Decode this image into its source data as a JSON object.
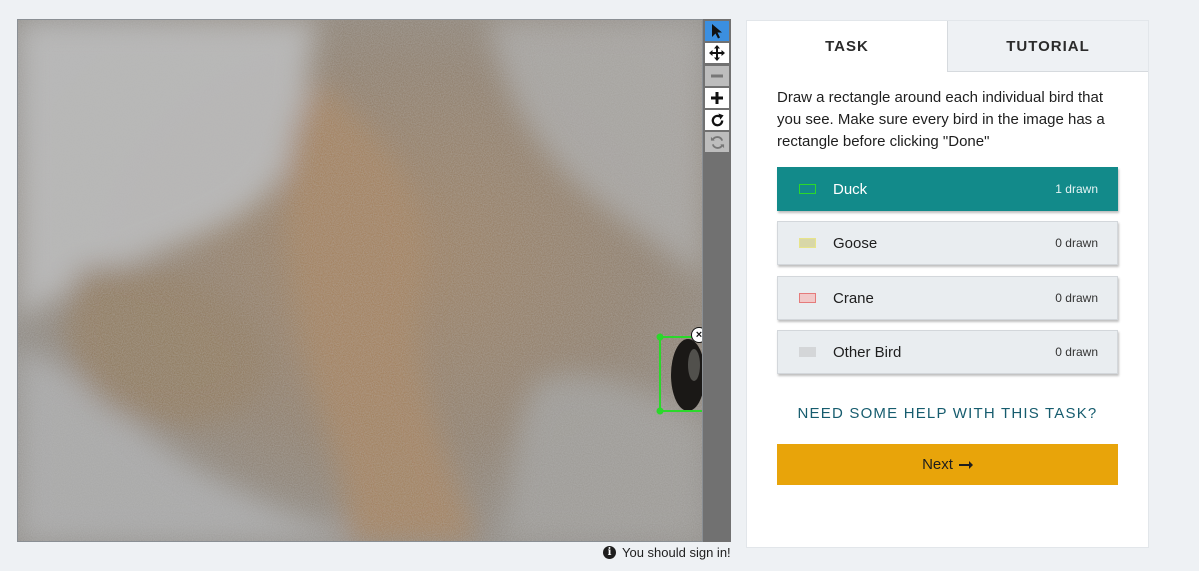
{
  "viewer": {
    "tools": [
      {
        "name": "pointer-icon",
        "state": "active"
      },
      {
        "name": "move-icon",
        "state": "normal"
      },
      {
        "name": "zoom-out-icon",
        "state": "disabled"
      },
      {
        "name": "zoom-in-icon",
        "state": "normal"
      },
      {
        "name": "rotate-icon",
        "state": "normal"
      },
      {
        "name": "reset-icon",
        "state": "disabled"
      }
    ],
    "annotation_color": "#2bd82b"
  },
  "signin_notice": "You should sign in!",
  "task_panel": {
    "tabs": {
      "task": "TASK",
      "tutorial": "TUTORIAL"
    },
    "instructions": "Draw a rectangle around each individual bird that you see. Make sure every bird in the image has a rectangle before clicking \"Done\"",
    "choices": [
      {
        "label": "Duck",
        "count": "1 drawn",
        "color": "#2bd82b",
        "selected": true
      },
      {
        "label": "Goose",
        "count": "0 drawn",
        "color": "#e7e48a",
        "selected": false
      },
      {
        "label": "Crane",
        "count": "0 drawn",
        "color": "#e57b7b",
        "selected": false
      },
      {
        "label": "Other Bird",
        "count": "0 drawn",
        "color": "#d4d6d8",
        "selected": false
      }
    ],
    "help_link": "NEED SOME HELP WITH THIS TASK?",
    "next_button": {
      "label": "Next",
      "icon": "arrow-right-icon"
    },
    "colors": {
      "selected": "#128a8a",
      "next": "#e8a40a",
      "link": "#165c6e"
    }
  }
}
